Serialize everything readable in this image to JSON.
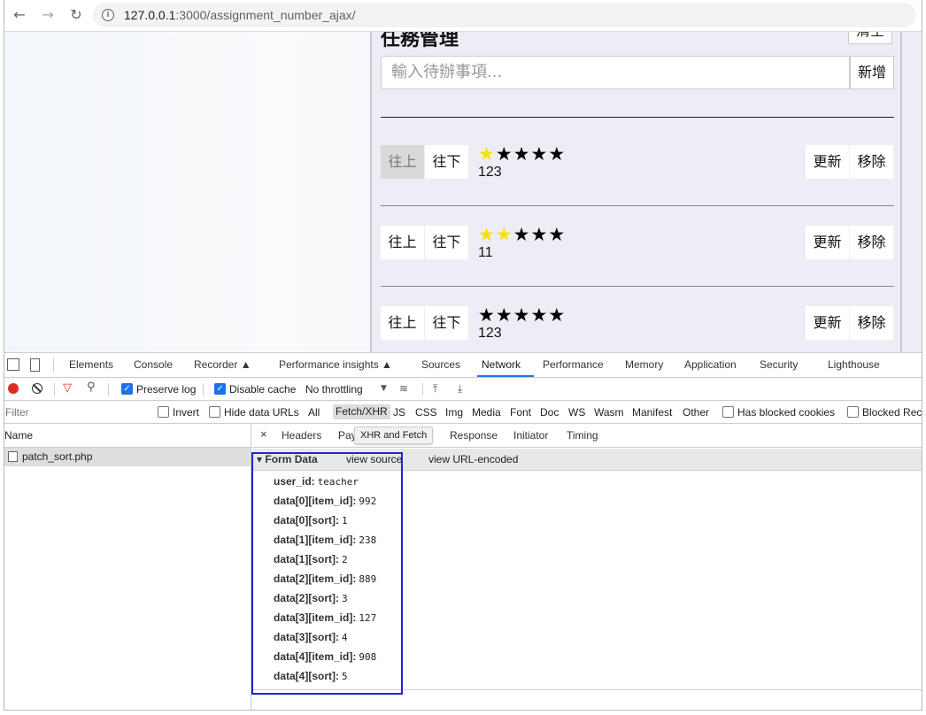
{
  "browser": {
    "url_host": "127.0.0.1",
    "url_path": ":3000/assignment_number_ajax/"
  },
  "app": {
    "title": "任務管理",
    "clear_label": "清空",
    "input_placeholder": "輸入待辦事項...",
    "add_label": "新增",
    "up_label": "往上",
    "down_label": "往下",
    "update_label": "更新",
    "remove_label": "移除",
    "tasks": [
      {
        "name": "123",
        "stars": 1,
        "up_disabled": true
      },
      {
        "name": "11",
        "stars": 2,
        "up_disabled": false
      },
      {
        "name": "123",
        "stars": 0,
        "up_disabled": false
      }
    ],
    "colors": {
      "star_on": "#f5e20a",
      "star_off": "#000000"
    }
  },
  "devtools": {
    "tabs": [
      "Elements",
      "Console",
      "Recorder ▲",
      "Performance insights ▲",
      "Sources",
      "Network",
      "Performance",
      "Memory",
      "Application",
      "Security",
      "Lighthouse"
    ],
    "active_tab": "Network",
    "preserve_log": "Preserve log",
    "disable_cache": "Disable cache",
    "throttling": "No throttling",
    "filter_placeholder": "Filter",
    "invert": "Invert",
    "hide_data_urls": "Hide data URLs",
    "types": [
      "All",
      "Fetch/XHR",
      "JS",
      "CSS",
      "Img",
      "Media",
      "Font",
      "Doc",
      "WS",
      "Wasm",
      "Manifest",
      "Other"
    ],
    "active_type": "Fetch/XHR",
    "has_blocked_cookies": "Has blocked cookies",
    "blocked_requests": "Blocked Rec",
    "name_header": "Name",
    "request_name": "patch_sort.php",
    "detail_tabs": {
      "close": "×",
      "headers": "Headers",
      "payload": "Pay",
      "tooltip": "XHR and Fetch",
      "response": "Response",
      "initiator": "Initiator",
      "timing": "Timing"
    },
    "form_data": {
      "title": "▾ Form Data",
      "view_source": "view source",
      "view_url_encoded": "view URL-encoded",
      "fields": [
        {
          "key": "user_id:",
          "value": "teacher"
        },
        {
          "key": "data[0][item_id]:",
          "value": "992"
        },
        {
          "key": "data[0][sort]:",
          "value": "1"
        },
        {
          "key": "data[1][item_id]:",
          "value": "238"
        },
        {
          "key": "data[1][sort]:",
          "value": "2"
        },
        {
          "key": "data[2][item_id]:",
          "value": "889"
        },
        {
          "key": "data[2][sort]:",
          "value": "3"
        },
        {
          "key": "data[3][item_id]:",
          "value": "127"
        },
        {
          "key": "data[3][sort]:",
          "value": "4"
        },
        {
          "key": "data[4][item_id]:",
          "value": "908"
        },
        {
          "key": "data[4][sort]:",
          "value": "5"
        }
      ]
    }
  }
}
